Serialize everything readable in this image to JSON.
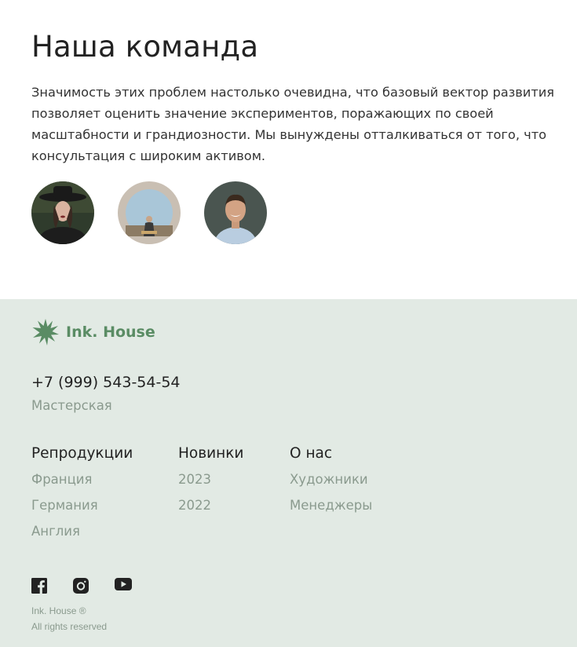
{
  "team": {
    "title": "Наша команда",
    "text": "Значимость этих проблем настолько очевидна, что базовый вектор развития позволяет оценить значение экспериментов, поражающих по своей масштабности и грандиозности. Мы вынуждены отталкиваться от того, что консультация с широким активом.",
    "avatars": [
      "avatar-woman-hat",
      "avatar-man-sitting",
      "avatar-man-smiling"
    ]
  },
  "footer": {
    "logo_text": "Ink. House",
    "logo_icon": "starburst-icon",
    "phone": "+7 (999) 543-54-54",
    "workshop": "Мастерская",
    "columns": [
      {
        "title": "Репродукции",
        "links": [
          "Франция",
          "Германия",
          "Англия"
        ]
      },
      {
        "title": "Новинки",
        "links": [
          "2023",
          "2022"
        ]
      },
      {
        "title": "О нас",
        "links": [
          "Художники",
          "Менеджеры"
        ]
      }
    ],
    "socials": [
      "facebook-icon",
      "instagram-icon",
      "youtube-icon"
    ],
    "copyright_line1": "Ink. House ®",
    "copyright_line2": "All rights reserved"
  },
  "colors": {
    "footer_bg": "#e2eae4",
    "brand_green": "#5a8c64",
    "muted_text": "#8a9a8e"
  }
}
